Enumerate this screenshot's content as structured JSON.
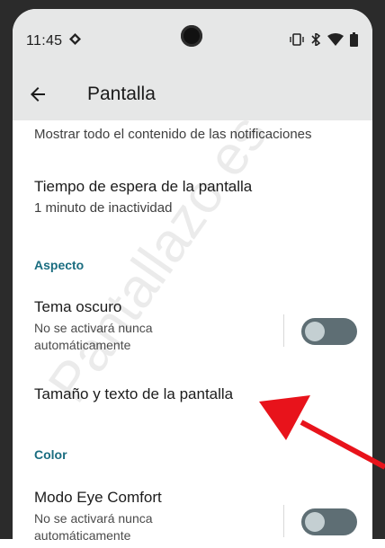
{
  "status_bar": {
    "time": "11:45"
  },
  "app_bar": {
    "title": "Pantalla"
  },
  "settings": {
    "notifications_subtitle": "Mostrar todo el contenido de las notificaciones",
    "screen_timeout": {
      "title": "Tiempo de espera de la pantalla",
      "subtitle": "1 minuto de inactividad"
    },
    "section_aspect": "Aspecto",
    "dark_theme": {
      "title": "Tema oscuro",
      "subtitle": "No se activará nunca automáticamente",
      "state": "off"
    },
    "text_size": {
      "title": "Tamaño y texto de la pantalla"
    },
    "section_color": "Color",
    "eye_comfort": {
      "title": "Modo Eye Comfort",
      "subtitle": "No se activará nunca automáticamente",
      "state": "off"
    }
  },
  "overlay": {
    "watermark": "Pantallazo.es",
    "arrow_color": "#e8131b"
  },
  "colors": {
    "accent": "#1a6d80",
    "toggle_track": "#5e6e74",
    "toggle_knob": "#c4cfd2",
    "appbar_bg": "#e6e7e7"
  }
}
